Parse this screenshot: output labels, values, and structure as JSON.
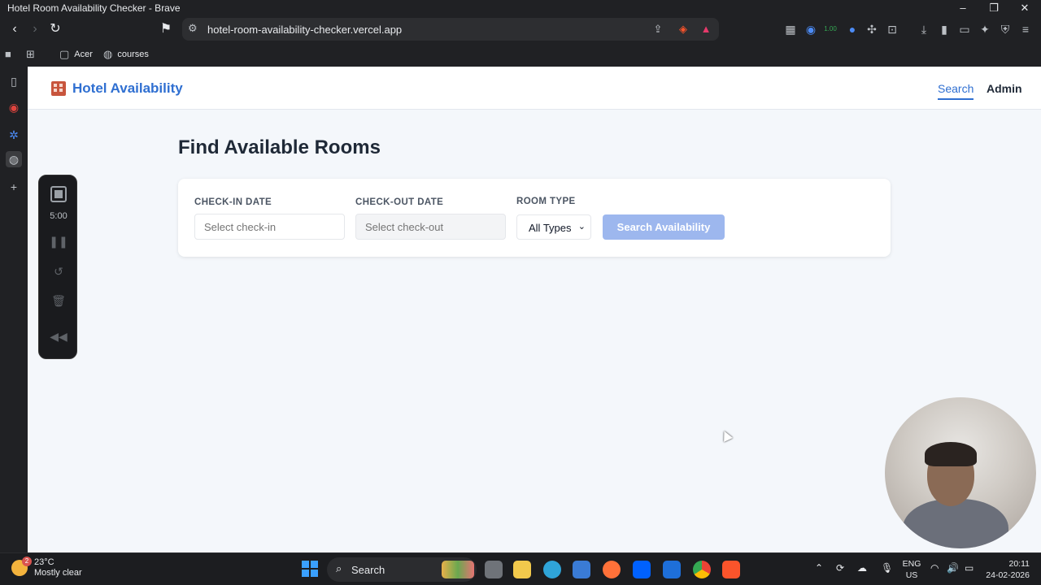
{
  "window": {
    "title": "Hotel Room Availability Checker - Brave"
  },
  "browser": {
    "url": "hotel-room-availability-checker.vercel.app",
    "bookmarks": [
      {
        "label": "Acer",
        "icon": "folder-icon"
      },
      {
        "label": "courses",
        "icon": "globe-icon"
      }
    ],
    "extension_badge": "1.00",
    "extension_count": "1"
  },
  "app": {
    "brand": "Hotel Availability",
    "nav": {
      "search": "Search",
      "admin": "Admin"
    },
    "page_title": "Find Available Rooms",
    "form": {
      "checkin_label": "CHECK-IN DATE",
      "checkin_placeholder": "Select check-in",
      "checkout_label": "CHECK-OUT DATE",
      "checkout_placeholder": "Select check-out",
      "roomtype_label": "ROOM TYPE",
      "roomtype_value": "All Types",
      "search_button": "Search Availability"
    }
  },
  "recorder": {
    "time": "5:00"
  },
  "taskbar": {
    "weather_temp": "23°C",
    "weather_desc": "Mostly clear",
    "weather_badge": "2",
    "search_label": "Search",
    "lang_top": "ENG",
    "lang_bottom": "US",
    "time": "20:11",
    "date": "24-02-2026"
  },
  "colors": {
    "accent": "#2f6fd1",
    "button_disabled": "#9db7ee",
    "page_bg": "#f4f7fb"
  }
}
